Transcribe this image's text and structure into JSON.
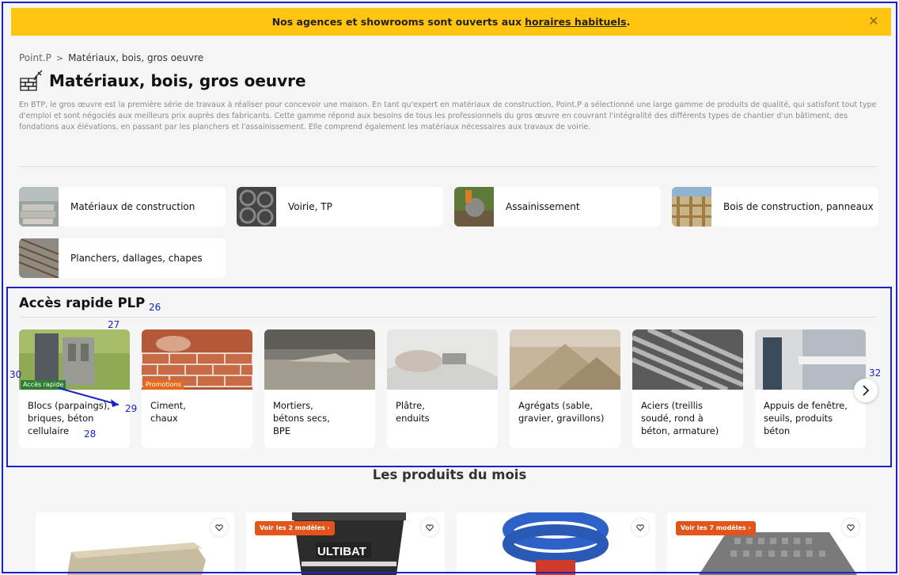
{
  "banner": {
    "text": "Nos agences et showrooms sont ouverts aux",
    "link": "horaires habituels",
    "suffix": ".",
    "close_icon": "close-icon"
  },
  "breadcrumb": {
    "home": "Point.P",
    "separator": ">",
    "current": "Matériaux, bois, gros oeuvre"
  },
  "page": {
    "title": "Matériaux, bois, gros oeuvre",
    "intro": "En BTP, le gros œuvre est la première série de travaux à réaliser pour concevoir une maison. En tant qu'expert en matériaux de construction, Point.P a sélectionné une large gamme de produits de qualité, qui satisfont tout type d'emploi et sont négociés aux meilleurs prix auprès des fabricants. Cette gamme répond aux besoins de tous les professionnels du gros œuvre en couvrant l'intégralité des différents types de chantier d'un bâtiment, des fondations aux élévations, en passant par les planchers et l'assainissement. Elle comprend également les matériaux nécessaires aux travaux de voirie."
  },
  "categories": [
    {
      "label": "Matériaux de construction"
    },
    {
      "label": "Voirie, TP"
    },
    {
      "label": "Assainissement"
    },
    {
      "label": "Bois de construction, panneaux"
    },
    {
      "label": "Planchers, dallages, chapes"
    }
  ],
  "quick_access": {
    "title": "Accès rapide PLP",
    "tiles": [
      {
        "label": "Blocs (parpaings),\nbriques, béton\ncellulaire",
        "badge": "Accès rapide"
      },
      {
        "label": "Ciment,\nchaux",
        "badge": "Promotions"
      },
      {
        "label": "Mortiers,\nbétons secs,\nBPE",
        "badge": ""
      },
      {
        "label": "Plâtre,\nenduits",
        "badge": ""
      },
      {
        "label": "Agrégats (sable,\ngravier, gravillons)",
        "badge": ""
      },
      {
        "label": "Aciers (treillis\nsoudé, rond à\nbéton, armature)",
        "badge": ""
      },
      {
        "label": "Appuis de fenêtre,\nseuils, produits\nbéton",
        "badge": ""
      }
    ],
    "next_icon": "chevron-right-icon"
  },
  "annotations": {
    "a26": "26",
    "a27": "27",
    "a28": "28",
    "a29": "29",
    "a30": "30",
    "a32": "32"
  },
  "products": {
    "title": "Les produits du mois",
    "cards": [
      {
        "variant_label": ""
      },
      {
        "variant_label": "Voir les 2 modèles ›",
        "brand": "ULTIBAT"
      },
      {
        "variant_label": ""
      },
      {
        "variant_label": "Voir les 7 modèles ›"
      }
    ]
  }
}
